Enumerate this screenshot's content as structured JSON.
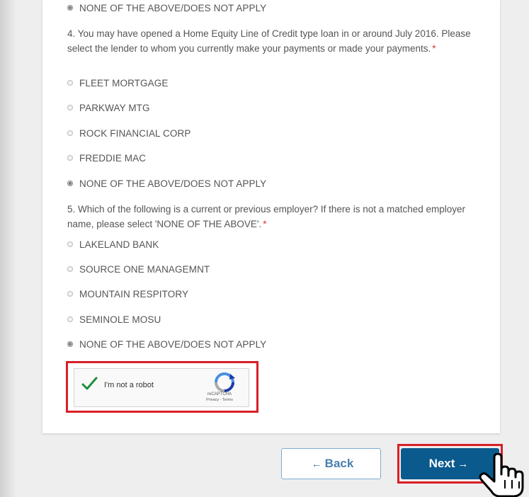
{
  "q3": {
    "selected_option": "NONE OF THE ABOVE/DOES NOT APPLY"
  },
  "q4": {
    "question": "4. You may have opened a Home Equity Line of Credit type loan in or around July 2016. Please select the lender to whom you currently make your payments or made your payments.",
    "required_marker": "*",
    "options": [
      "FLEET MORTGAGE",
      "PARKWAY MTG",
      "ROCK FINANCIAL CORP",
      "FREDDIE MAC",
      "NONE OF THE ABOVE/DOES NOT APPLY"
    ],
    "selected": "NONE OF THE ABOVE/DOES NOT APPLY"
  },
  "q5": {
    "question": "5. Which of the following is a current or previous employer? If there is not a matched employer name, please select 'NONE OF THE ABOVE'.",
    "required_marker": "*",
    "options": [
      "LAKELAND BANK",
      "SOURCE ONE MANAGEMNT",
      "MOUNTAIN RESPITORY",
      "SEMINOLE MOSU",
      "NONE OF THE ABOVE/DOES NOT APPLY"
    ],
    "selected": "NONE OF THE ABOVE/DOES NOT APPLY"
  },
  "captcha": {
    "label": "I'm not a robot",
    "brand": "reCAPTCHA",
    "terms": "Privacy - Terms",
    "checked": true
  },
  "buttons": {
    "back": "Back",
    "next": "Next"
  },
  "colors": {
    "primary": "#0a5a8e",
    "highlight": "#d81f26",
    "required": "#d9342b",
    "check": "#1e8e3e"
  }
}
